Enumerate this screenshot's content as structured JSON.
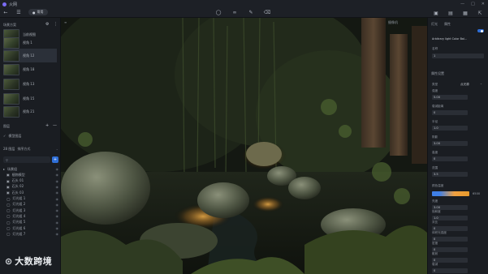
{
  "app": {
    "title": "火网"
  },
  "toolbar": {
    "back_icon": "arrow-left",
    "menu_icon": "hamburger",
    "quick_pill": "常用",
    "center_tools": [
      "bulb-icon",
      "link-icon",
      "pen-icon",
      "eraser-icon"
    ],
    "right_tools": [
      "camera-icon",
      "save-icon",
      "folder-icon",
      "export-icon"
    ]
  },
  "left_panel": {
    "scenes_title": "场景方案",
    "scenes": [
      {
        "label": "当前视图",
        "selected": false
      },
      {
        "label": "视角 1",
        "selected": false
      },
      {
        "label": "视角 12",
        "selected": true
      },
      {
        "label": "视角 18",
        "selected": false
      },
      {
        "label": "视角 13",
        "selected": false
      },
      {
        "label": "视角 15",
        "selected": false
      },
      {
        "label": "视角 21",
        "selected": false
      }
    ],
    "layers_title": "图层",
    "layer_group": "模型图层",
    "sort_label": "28 图层",
    "sort_value": "排序方式",
    "search_placeholder": "",
    "tree": [
      {
        "label": "场景组",
        "indent": 0
      },
      {
        "label": "植物模型",
        "indent": 1
      },
      {
        "label": "石头 01",
        "indent": 1
      },
      {
        "label": "石头 02",
        "indent": 1
      },
      {
        "label": "石头 03",
        "indent": 1
      },
      {
        "label": "灯光组 1",
        "indent": 1
      },
      {
        "label": "灯光组 2",
        "indent": 1
      },
      {
        "label": "灯光组 3",
        "indent": 1
      },
      {
        "label": "灯光组 4",
        "indent": 1
      },
      {
        "label": "灯光组 5",
        "indent": 1
      },
      {
        "label": "灯光组 6",
        "indent": 1
      },
      {
        "label": "灯光组 7",
        "indent": 1
      }
    ]
  },
  "viewport": {
    "top_left_label": "≡",
    "top_right_label": "摄像机"
  },
  "right_panel": {
    "tab": "灯光",
    "tab2": "属性",
    "light_name": "Arbitrary light Color Bal...",
    "name_label": "名称",
    "name_value": "1",
    "section2": "属性设置",
    "type_label": "类型",
    "type_value": "点光源",
    "fields": [
      {
        "label": "强度",
        "value": "5.00"
      },
      {
        "label": "衰减距离",
        "value": "0"
      },
      {
        "label": "半径",
        "value": "1.0"
      },
      {
        "label": "阴影",
        "value": "3.00"
      },
      {
        "label": "高度",
        "value": "0"
      },
      {
        "label": "范围",
        "value": "3.5"
      }
    ],
    "color_label": "颜色温度",
    "color_value": "6500",
    "fields2": [
      {
        "label": "亮度",
        "value": "3.00"
      },
      {
        "label": "饱和度",
        "value": "1.0"
      },
      {
        "label": "对比",
        "value": "0"
      },
      {
        "label": "体积光强度",
        "value": "0"
      },
      {
        "label": "密度",
        "value": "0"
      },
      {
        "label": "散射",
        "value": "0"
      },
      {
        "label": "衰减",
        "value": "0"
      }
    ]
  },
  "watermark": {
    "text": "大数跨境"
  },
  "colors": {
    "accent": "#2f6fd8",
    "warm_light": "#f0a040"
  }
}
